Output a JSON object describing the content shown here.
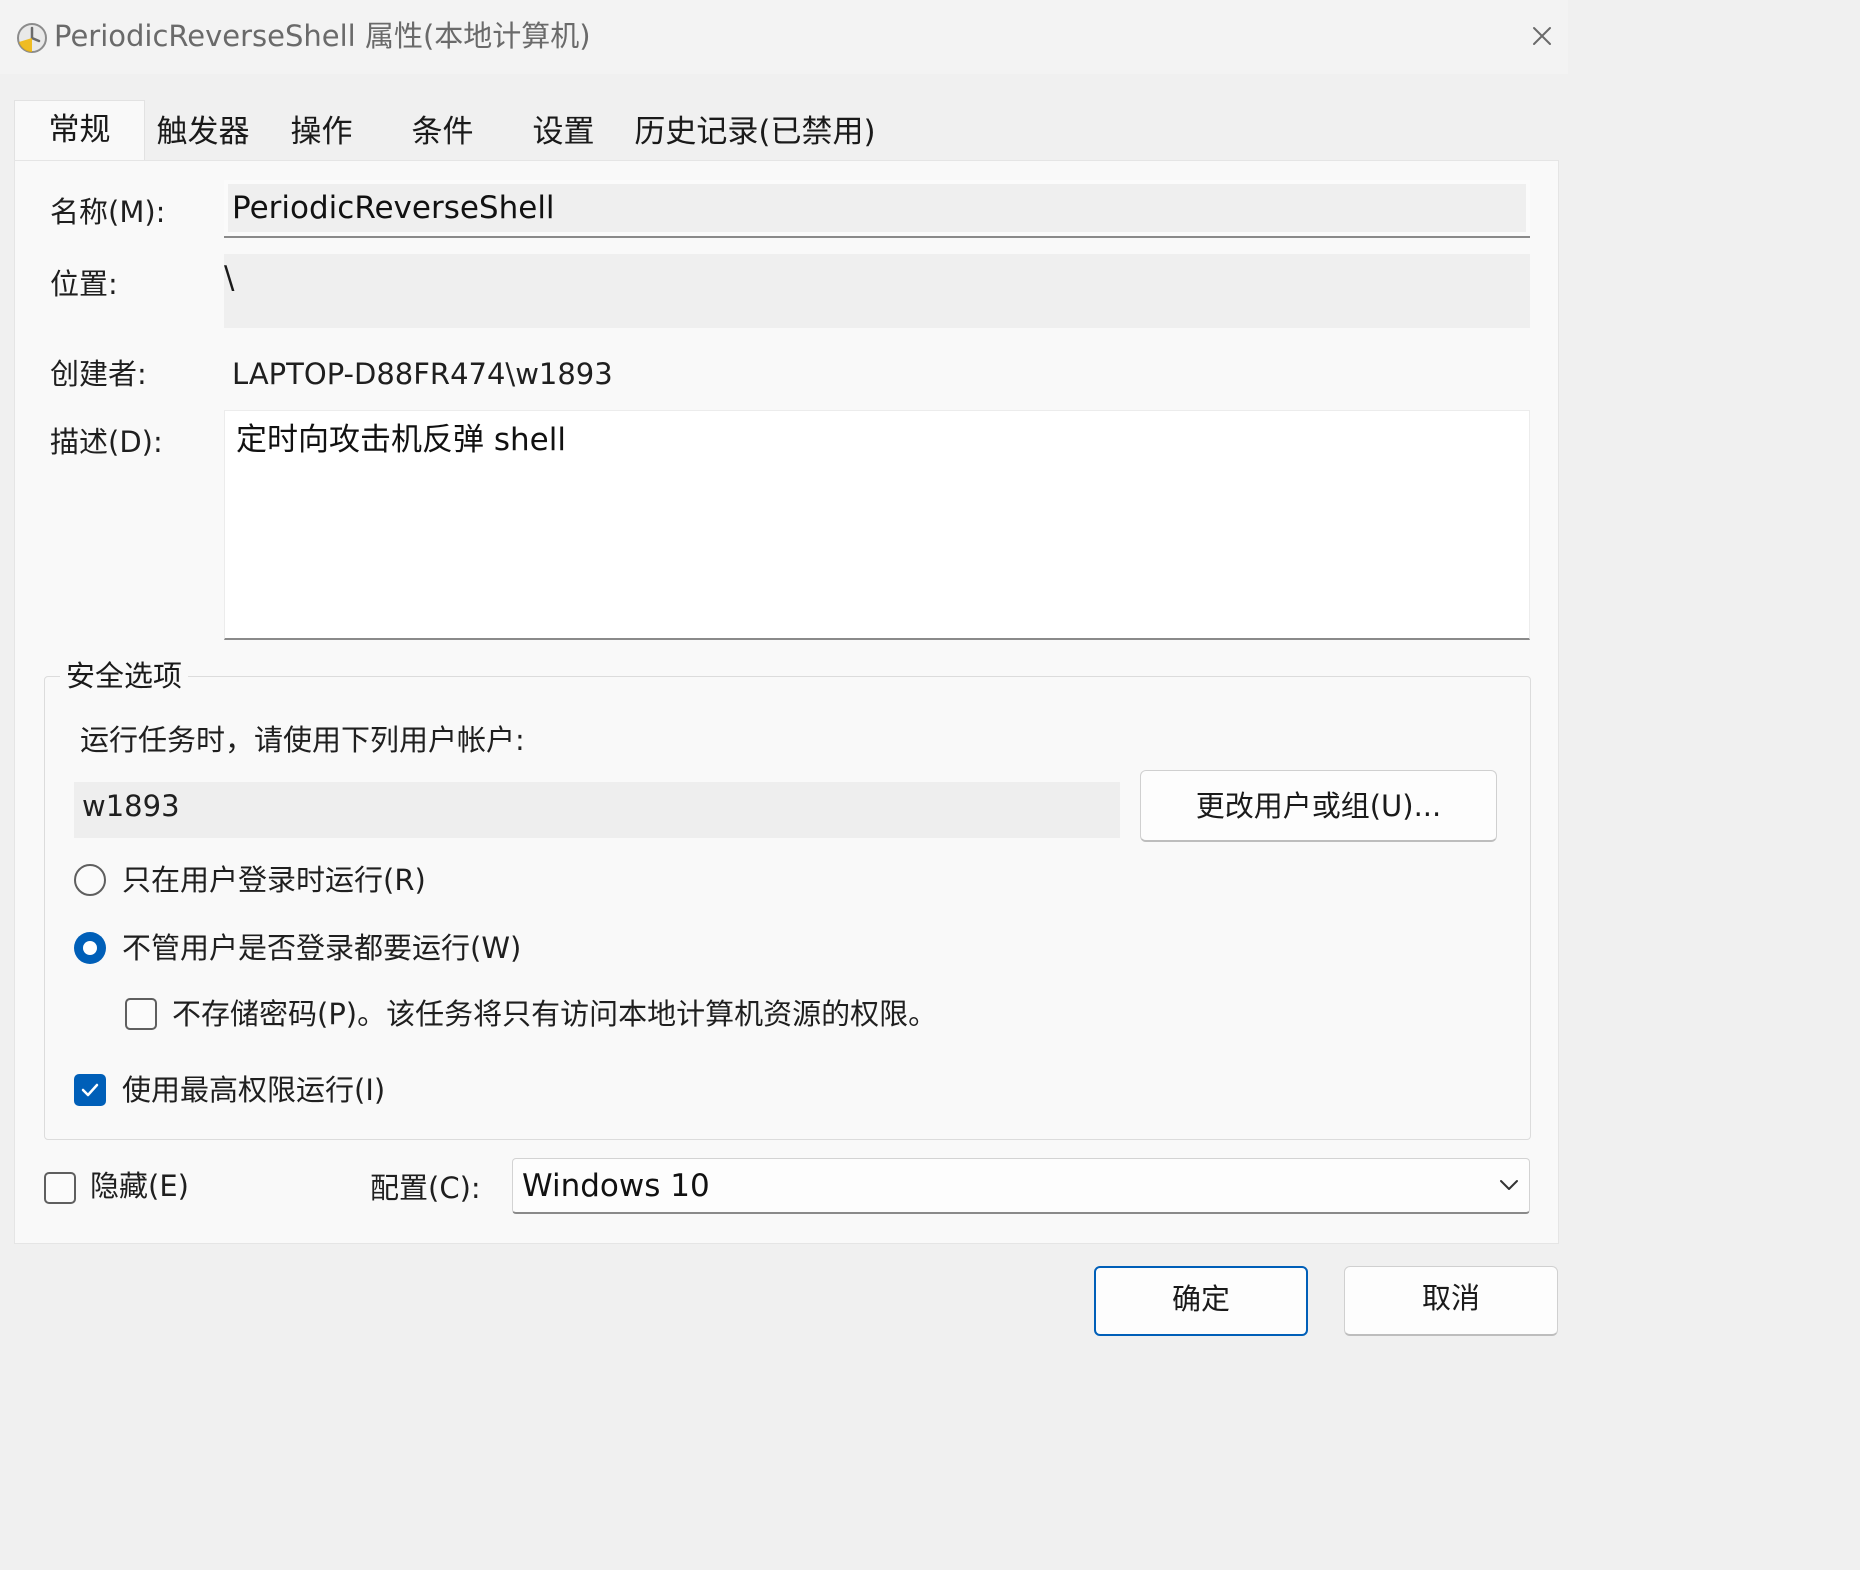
{
  "window": {
    "title": "PeriodicReverseShell 属性(本地计算机)",
    "icon": "clock-icon",
    "close_icon": "close-icon"
  },
  "tabs": [
    {
      "label": "常规",
      "active": true
    },
    {
      "label": "触发器"
    },
    {
      "label": "操作"
    },
    {
      "label": "条件"
    },
    {
      "label": "设置"
    },
    {
      "label": "历史记录(已禁用)"
    }
  ],
  "general": {
    "name_label": "名称(M):",
    "name_value": "PeriodicReverseShell",
    "location_label": "位置:",
    "location_value": "\\",
    "author_label": "创建者:",
    "author_value": "LAPTOP-D88FR474\\w1893",
    "description_label": "描述(D):",
    "description_value": "定时向攻击机反弹 shell"
  },
  "security": {
    "group_title": "安全选项",
    "run_as_label": "运行任务时，请使用下列用户帐户:",
    "user_value": "w1893",
    "change_button": "更改用户或组(U)...",
    "radio_logged_on": {
      "label": "只在用户登录时运行(R)",
      "checked": false
    },
    "radio_whether": {
      "label": "不管用户是否登录都要运行(W)",
      "checked": true
    },
    "no_store_password": {
      "label": "不存储密码(P)。该任务将只有访问本地计算机资源的权限。",
      "checked": false
    },
    "highest_privileges": {
      "label": "使用最高权限运行(I)",
      "checked": true
    }
  },
  "bottom": {
    "hidden": {
      "label": "隐藏(E)",
      "checked": false
    },
    "configure_label": "配置(C):",
    "configure_value": "Windows 10"
  },
  "buttons": {
    "ok": "确定",
    "cancel": "取消"
  },
  "colors": {
    "accent": "#005fb8",
    "window_bg": "#f0f0f0",
    "panel_bg": "#f9f9f9"
  }
}
